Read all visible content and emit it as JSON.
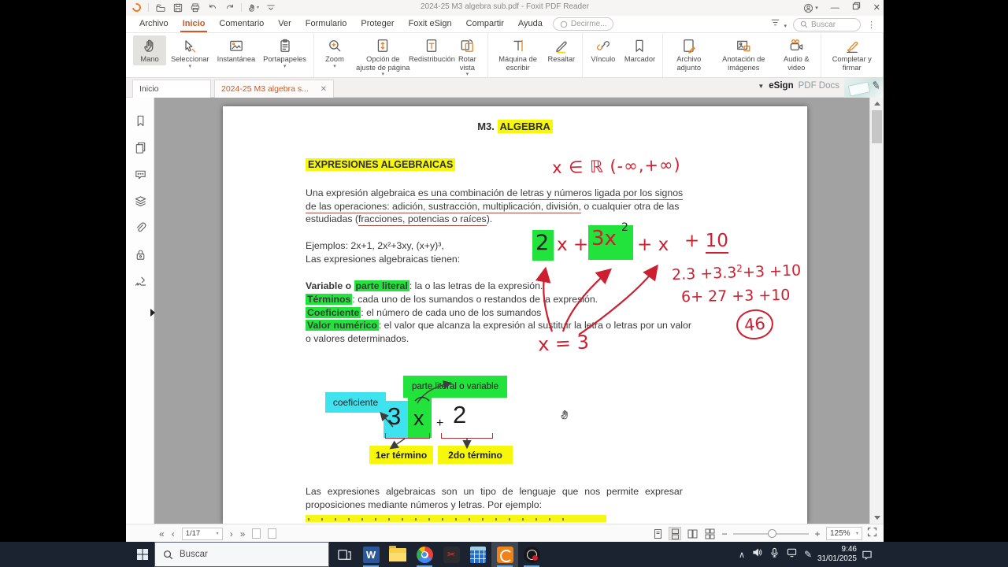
{
  "window": {
    "title": "2024-25 M3 algebra sub.pdf - Foxit PDF Reader"
  },
  "quick_access": {
    "icons": [
      "foxit-logo",
      "open-file",
      "save",
      "print",
      "undo",
      "redo",
      "hand-tool",
      "customize-toolbar"
    ]
  },
  "menu": {
    "items": [
      {
        "label": "Archivo",
        "active": false
      },
      {
        "label": "Inicio",
        "active": true
      },
      {
        "label": "Comentario",
        "active": false
      },
      {
        "label": "Ver",
        "active": false
      },
      {
        "label": "Formulario",
        "active": false
      },
      {
        "label": "Proteger",
        "active": false
      },
      {
        "label": "Foxit eSign",
        "active": false
      },
      {
        "label": "Compartir",
        "active": false
      },
      {
        "label": "Ayuda",
        "active": false
      }
    ],
    "tell_me": "Decirme...",
    "search": "Buscar"
  },
  "toolbar": {
    "groups": [
      [
        {
          "label": "Mano",
          "icon": "hand",
          "selected": true
        },
        {
          "label": "Seleccionar",
          "icon": "select",
          "dd": true
        },
        {
          "label": "Instantánea",
          "icon": "snapshot"
        },
        {
          "label": "Portapapeles",
          "icon": "clipboard",
          "dd": true
        }
      ],
      [
        {
          "label": "Zoom",
          "icon": "zoom",
          "dd": true
        },
        {
          "label": "Opción de ajuste de página",
          "icon": "fitpage",
          "dd": true
        },
        {
          "label": "Redistribución",
          "icon": "reflow"
        },
        {
          "label": "Rotar vista",
          "icon": "rotate",
          "dd": true
        }
      ],
      [
        {
          "label": "Máquina de escribir",
          "icon": "typewriter"
        },
        {
          "label": "Resaltar",
          "icon": "highlight"
        }
      ],
      [
        {
          "label": "Vínculo",
          "icon": "link"
        },
        {
          "label": "Marcador",
          "icon": "bookmark"
        }
      ],
      [
        {
          "label": "Archivo adjunto",
          "icon": "attach"
        },
        {
          "label": "Anotación de imágenes",
          "icon": "imgannot"
        },
        {
          "label": "Audio & video",
          "icon": "av"
        }
      ],
      [
        {
          "label": "Completar y firmar",
          "icon": "sign"
        }
      ]
    ]
  },
  "tabs": {
    "home": "Inicio",
    "document": "2024-25 M3 algebra s...",
    "esign_bold": "eSign",
    "esign_rest": "PDF Docs"
  },
  "sidebar": {
    "icons": [
      "bookmarks",
      "pages",
      "comments",
      "layers",
      "attachments",
      "security",
      "signatures"
    ]
  },
  "statusbar": {
    "page": "1/17",
    "zoom": "125%"
  },
  "taskbar": {
    "search": "Buscar",
    "apps": [
      {
        "name": "task-view",
        "open": false
      },
      {
        "name": "word",
        "open": true
      },
      {
        "name": "file-explorer",
        "open": false
      },
      {
        "name": "chrome",
        "open": true
      },
      {
        "name": "video-app",
        "open": false
      },
      {
        "name": "calculator",
        "open": false
      },
      {
        "name": "foxit",
        "open": true,
        "active": true
      },
      {
        "name": "obs",
        "open": true
      }
    ],
    "time": "9:46",
    "date": "31/01/2025"
  },
  "document": {
    "title_prefix": "M3. ",
    "title_highlight": "ALGEBRA",
    "heading": "EXPRESIONES ALGEBRAICAS",
    "domain_note": "x ∈ ℝ (-∞,+∞)",
    "para1": [
      [
        {
          "t": "Una expresión algebraica "
        },
        {
          "t": "es una combinación de letras y números ligada por los signos",
          "u": true
        }
      ],
      [
        {
          "t": "de las operaciones: adición, sustracción, multiplicación, división,",
          "u": true
        },
        {
          "t": " o cualquier otra de las"
        }
      ],
      [
        {
          "t": "estudiadas ("
        },
        {
          "t": "fracciones, potencias o raíces",
          "u": true
        },
        {
          "t": ")."
        }
      ]
    ],
    "ejemplos": "Ejemplos: 2x+1, 2x²+3xy, (x+y)³,",
    "tienen": "Las expresiones algebraicas tienen:",
    "definitions": [
      {
        "pre": "Variable o ",
        "hl": "parte literal",
        "rest": ": la o las letras de la expresión."
      },
      {
        "pre": "",
        "hl": "Términos",
        "rest": ": cada uno de los sumandos o restandos de la expresión."
      },
      {
        "pre": "",
        "hl": "Coeficiente",
        "rest": ": el número de cada uno de los sumandos"
      },
      {
        "pre": "",
        "hl": "Valor numérico",
        "rest": ": el valor que alcanza la expresión al sustituir la letra o letras por un valor"
      },
      {
        "pre": "",
        "hl": "",
        "rest": "o valores determinados."
      }
    ],
    "handwriting": {
      "coef1": "2",
      "x1": "x +",
      "term2": "3x",
      "term2_sup": "2",
      "x2": "+ x",
      "tail_plus": "+",
      "tail_num": "10",
      "calc1a": "2.3 +3.3",
      "calc1_sup": "2",
      "calc1b": "+3 +10",
      "calc2": "6+ 27 +3 +10",
      "result": "46",
      "subst": "x = 3"
    },
    "diagram": {
      "coef_label": "coeficiente",
      "literal_label": "parte literal o variable",
      "coef": "3",
      "variable": "x",
      "plus": "+",
      "second_term": "2",
      "term1": "1er término",
      "term2": "2do término"
    },
    "para2": [
      "Las expresiones algebraicas son un tipo de lenguaje que nos permite expresar",
      "proposiciones mediante números y letras. Por ejemplo:"
    ],
    "colors": {
      "accent_orange": "#cb5a24",
      "highlight_yellow": "#f7f70a",
      "highlight_green": "#22e23c",
      "highlight_cyan": "#3fe3ef",
      "annotation_red": "#cc2030"
    }
  }
}
